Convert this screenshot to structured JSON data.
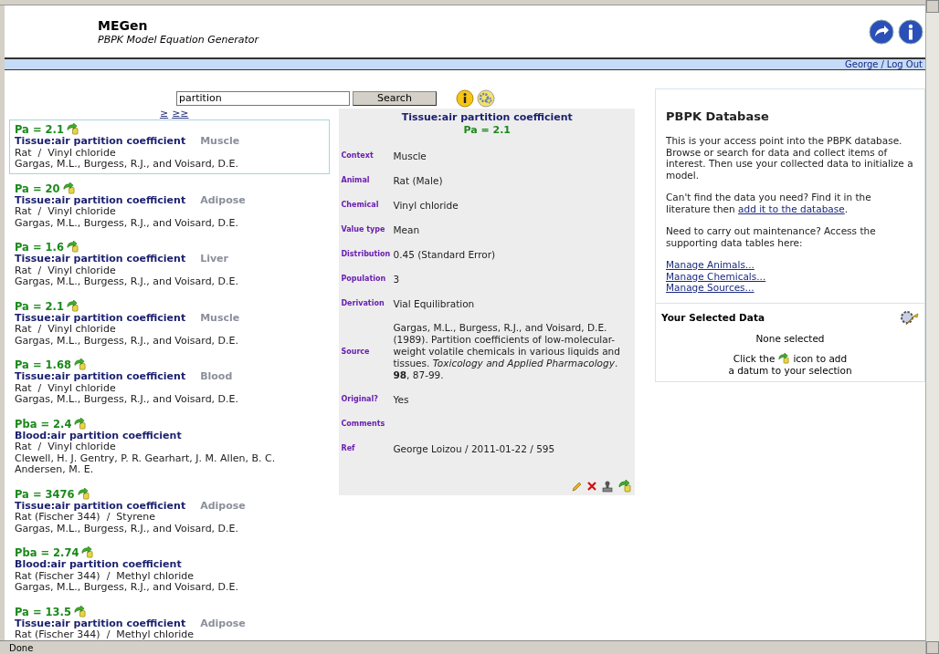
{
  "header": {
    "title": "MEGen",
    "subtitle": "PBPK Model Equation Generator"
  },
  "user_bar": {
    "user": "George",
    "separator": "/",
    "logout": "Log Out"
  },
  "search": {
    "value": "partition",
    "button": "Search"
  },
  "pager": [
    "≥",
    "≥≥"
  ],
  "results": [
    {
      "value": "Pa = 2.1",
      "title": "Tissue:air partition coefficient",
      "context": "Muscle",
      "organism": "Rat  /  Vinyl chloride",
      "authors": "Gargas, M.L., Burgess, R.J., and Voisard, D.E.",
      "selected": true
    },
    {
      "value": "Pa = 20",
      "title": "Tissue:air partition coefficient",
      "context": "Adipose",
      "organism": "Rat  /  Vinyl chloride",
      "authors": "Gargas, M.L., Burgess, R.J., and Voisard, D.E.",
      "selected": false
    },
    {
      "value": "Pa = 1.6",
      "title": "Tissue:air partition coefficient",
      "context": "Liver",
      "organism": "Rat  /  Vinyl chloride",
      "authors": "Gargas, M.L., Burgess, R.J., and Voisard, D.E.",
      "selected": false
    },
    {
      "value": "Pa = 2.1",
      "title": "Tissue:air partition coefficient",
      "context": "Muscle",
      "organism": "Rat  /  Vinyl chloride",
      "authors": "Gargas, M.L., Burgess, R.J., and Voisard, D.E.",
      "selected": false
    },
    {
      "value": "Pa = 1.68",
      "title": "Tissue:air partition coefficient",
      "context": "Blood",
      "organism": "Rat  /  Vinyl chloride",
      "authors": "Gargas, M.L., Burgess, R.J., and Voisard, D.E.",
      "selected": false
    },
    {
      "value": "Pba = 2.4",
      "title": "Blood:air partition coefficient",
      "organism": "Rat  /  Vinyl chloride",
      "authors": "Clewell, H. J. Gentry, P. R. Gearhart, J. M. Allen, B. C. Andersen, M. E.",
      "selected": false
    },
    {
      "value": "Pa = 3476",
      "title": "Tissue:air partition coefficient",
      "context": "Adipose",
      "organism": "Rat (Fischer 344)  /  Styrene",
      "authors": "Gargas, M.L., Burgess, R.J., and Voisard, D.E.",
      "selected": false
    },
    {
      "value": "Pba = 2.74",
      "title": "Blood:air partition coefficient",
      "organism": "Rat (Fischer 344)  /  Methyl chloride",
      "authors": "Gargas, M.L., Burgess, R.J., and Voisard, D.E.",
      "selected": false
    },
    {
      "value": "Pa = 13.5",
      "title": "Tissue:air partition coefficient",
      "context": "Adipose",
      "organism": "Rat (Fischer 344)  /  Methyl chloride",
      "selected": false
    }
  ],
  "detail": {
    "title": "Tissue:air partition coefficient",
    "value": "Pa = 2.1",
    "fields": [
      {
        "label": "Context",
        "value": "Muscle"
      },
      {
        "label": "Animal",
        "value": "Rat (Male)"
      },
      {
        "label": "Chemical",
        "value": "Vinyl chloride"
      },
      {
        "label": "Value type",
        "value": "Mean"
      },
      {
        "label": "Distribution",
        "value": "0.45 (Standard Error)"
      },
      {
        "label": "Population",
        "value": "3"
      },
      {
        "label": "Derivation",
        "value": "Vial Equilibration"
      },
      {
        "label": "Source",
        "value": "Gargas, M.L., Burgess, R.J., and Voisard, D.E. (1989). Partition coefficients of low-molecular-weight volatile chemicals in various liquids and tissues. *Toxicology and Applied Pharmacology*. **98**, 87-99."
      },
      {
        "label": "Original?",
        "value": "Yes"
      },
      {
        "label": "Comments"
      },
      {
        "label": "Ref",
        "value": "George Loizou / 2011-01-22 / 595"
      }
    ]
  },
  "database": {
    "title": "PBPK Database",
    "intro": "This is your access point into the PBPK database. Browse or search for data and collect items of interest. Then use your collected data to initialize a model.",
    "missing_before": "Can't find the data you need? Find it in the literature then",
    "missing_link": "add it to the database",
    "missing_after": ".",
    "maintenance": "Need to carry out maintenance? Access the supporting data tables here:",
    "links": [
      "Manage Animals...",
      "Manage Chemicals...",
      "Manage Sources..."
    ]
  },
  "selected_data": {
    "title": "Your Selected Data",
    "empty": "None selected",
    "hint_before": "Click the",
    "hint_after": "icon to add",
    "hint_line2": "a datum to your selection"
  },
  "status_bar": "Done"
}
